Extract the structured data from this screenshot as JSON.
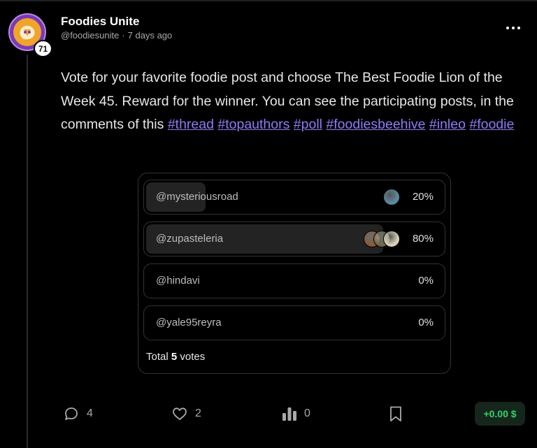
{
  "author": {
    "name": "Foodies Unite",
    "handle": "@foodiesunite",
    "time": "7 days ago",
    "reputation": "71",
    "avatar_icon": "foodies-unite-logo"
  },
  "post": {
    "text_before_tags": "Vote for your favorite foodie post and choose The Best Foodie Lion of the Week 45. Reward for the winner. You can see the participating posts, in the comments of this",
    "tags": [
      "#thread",
      "#topauthors",
      "#poll",
      "#foodiesbeehive",
      "#inleo",
      "#foodie"
    ]
  },
  "poll": {
    "options": [
      {
        "label": "@mysteriousroad",
        "percent": "20%",
        "share": 0.2,
        "voter_colors": [
          "#5a8aa0"
        ]
      },
      {
        "label": "@zupasteleria",
        "percent": "80%",
        "share": 0.8,
        "voter_colors": [
          "#8a5a3a",
          "#6b6b4a",
          "#d8d0b8"
        ]
      },
      {
        "label": "@hindavi",
        "percent": "0%",
        "share": 0,
        "voter_colors": []
      },
      {
        "label": "@yale95reyra",
        "percent": "0%",
        "share": 0,
        "voter_colors": []
      }
    ],
    "total_prefix": "Total",
    "total_votes": "5",
    "total_suffix": "votes"
  },
  "actions": {
    "comments": "4",
    "likes": "2",
    "stats": "0",
    "reward": "+0.00 $"
  },
  "colors": {
    "background": "#000000",
    "hashtag": "#8b7cf6",
    "reward_text": "#2fd36a",
    "avatar_ring": "#7a39b6"
  }
}
